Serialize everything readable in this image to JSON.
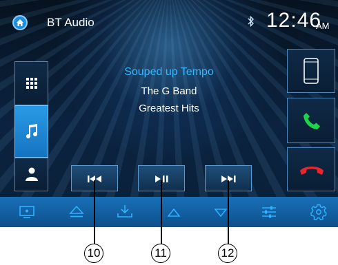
{
  "header": {
    "source": "BT Audio",
    "time": "12:46",
    "ampm": "AM"
  },
  "track": {
    "song": "Souped up Tempo",
    "artist": "The G Band",
    "album": "Greatest Hits"
  },
  "sidebar": {
    "items": [
      {
        "name": "apps",
        "icon": "grid-icon"
      },
      {
        "name": "music",
        "icon": "music-note-icon",
        "active": true
      },
      {
        "name": "contacts",
        "icon": "person-icon"
      }
    ]
  },
  "right_panel": {
    "items": [
      {
        "name": "phone",
        "icon": "smartphone-icon"
      },
      {
        "name": "call",
        "icon": "call-accept-icon",
        "color": "#1fd24a"
      },
      {
        "name": "end-call",
        "icon": "call-end-icon",
        "color": "#e8262e"
      }
    ]
  },
  "controls": [
    "previous-icon",
    "play-pause-icon",
    "next-icon"
  ],
  "bottom_bar": [
    "screen-icon",
    "eject-icon",
    "download-icon",
    "up-arrow-icon",
    "down-arrow-icon",
    "equalizer-icon",
    "settings-icon"
  ],
  "callouts": [
    "10",
    "11",
    "12"
  ],
  "colors": {
    "accent": "#36b8ff",
    "bar": "#1870b8",
    "call_green": "#1fd24a",
    "call_red": "#e8262e"
  }
}
